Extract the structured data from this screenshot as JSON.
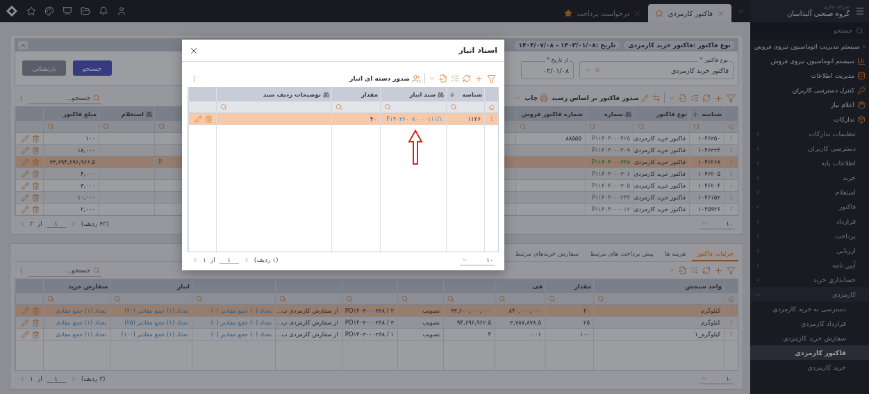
{
  "top_bar": {
    "company_caption": "شرکت جاری",
    "company": "گروه صنعتی آلیداسان",
    "tabs": [
      {
        "label": "فاکتور کارمزدی",
        "selected": true,
        "starred": false
      },
      {
        "label": "درخواست پرداخت",
        "selected": false,
        "starred": true
      }
    ]
  },
  "sidebar": {
    "search_placeholder": "جستجو",
    "items": [
      {
        "label": "سیستم مدیریت اتوماسیون نیروی فروش"
      },
      {
        "label": "سیستم اتوماسیون نیروی فروش"
      },
      {
        "label": "مدیریت اطلاعات"
      },
      {
        "label": "کنترل دسترسی کاربران"
      },
      {
        "label": "اعلام نیاز"
      },
      {
        "label": "تدارکات",
        "children": [
          {
            "label": "تنظیمات تدارکات",
            "expanded": false
          },
          {
            "label": "دسترسی کاربران",
            "expanded": false
          },
          {
            "label": "اطلاعات پایه",
            "expanded": false
          },
          {
            "label": "خرید",
            "expanded": false
          },
          {
            "label": "استعلام",
            "expanded": false
          },
          {
            "label": "فاکتور",
            "expanded": false
          },
          {
            "label": "قرارداد",
            "expanded": false
          },
          {
            "label": "پرداخت",
            "expanded": false
          },
          {
            "label": "ارزیابی",
            "expanded": false
          },
          {
            "label": "آیین نامه",
            "expanded": false
          },
          {
            "label": "حسابداری خرید",
            "expanded": false
          },
          {
            "label": "کارمزدی",
            "expanded": true,
            "children": [
              {
                "label": "دسترسی به خرید کارمزدی",
                "selected": false
              },
              {
                "label": "قرارداد کارمزدی",
                "selected": false
              },
              {
                "label": "سفارش خرید کارمزدی",
                "selected": false
              },
              {
                "label": "فاکتور کارمزدی",
                "selected": true
              },
              {
                "label": "خرید کارمزدی",
                "selected": false
              }
            ]
          }
        ]
      }
    ]
  },
  "filter": {
    "summary": [
      "نوع فاکتور :فاکتور خرید کارمزدی",
      "تاریخ :۱۴۰۳/۰۱/۰۸ - ۱۴۰۴/۰۷/۰۸"
    ],
    "fields": [
      {
        "kind": "select",
        "label": "نوع فاکتور *",
        "value": "فاکتور خرید کارمزدی"
      },
      {
        "kind": "date",
        "label": "از تاریخ *",
        "value": "۰۳/۰۱/۰۸"
      }
    ],
    "buttons": [
      {
        "kind": "primary",
        "label": "جستجو"
      },
      {
        "kind": "secondary",
        "label": "بازنشانی"
      }
    ]
  },
  "invoices": {
    "actions": [
      "صدور فاکتور بر اساس رسید",
      "چاپ"
    ],
    "search_placeholder": "جستجو...",
    "columns": [
      {
        "label": "شناسه",
        "sorted": true,
        "lookup": false,
        "kind": "text"
      },
      {
        "label": "نوع فاکتور",
        "sorted": false,
        "lookup": false,
        "kind": "text"
      },
      {
        "label": "شماره",
        "sorted": false,
        "lookup": true,
        "kind": "code"
      },
      {
        "label": "شماره فاکتور فروش",
        "sorted": false,
        "lookup": false,
        "kind": "text"
      },
      {
        "sorted": false,
        "lookup": false,
        "kind": "clipped"
      },
      {
        "label": "استعلام",
        "sorted": false,
        "lookup": true,
        "kind": "text"
      },
      {
        "label": "مبلغ فاکتور",
        "sorted": false,
        "lookup": false,
        "kind": "text"
      }
    ],
    "rows": [
      {
        "selected": false,
        "cells": [
          "۱۰۴۶۳۵۰",
          "فاکتور خرید کارمزدی",
          "P۱۱۴۰۴۰۰۰۴۲۵",
          "۸۸۵۵۵",
          null,
          null,
          "۱۰۰"
        ]
      },
      {
        "selected": false,
        "cells": [
          "۱۰۴۶۳۳۴",
          "فاکتور خرید کارمزدی",
          "P۱۱۴۰۴۰۰۰۴۰۹",
          null,
          null,
          null,
          "۱۸,۰۰۰"
        ]
      },
      {
        "selected": true,
        "cells": [
          "۱۰۴۶۲۶۸",
          "فاکتور خرید کارمزدی",
          "P۱۱۴۰۴۰۰۰۳۳۸",
          null,
          "P",
          null,
          "۳۳,۶۹۴,۶۹۶,۹۶۶.۵"
        ]
      },
      {
        "selected": false,
        "cells": [
          "۱۰۴۶۲۰۵",
          "فاکتور خرید کارمزدی",
          "P۱۱۴۰۴۰۰۰۳۰۶",
          null,
          null,
          null,
          "۴,۰۰۰"
        ]
      },
      {
        "selected": false,
        "cells": [
          "۱۰۴۶۲۰۴",
          "فاکتور خرید کارمزدی",
          "P۱۱۴۰۴۰۰۰۳۰۵",
          null,
          null,
          null,
          "۳,۰۰۰"
        ]
      },
      {
        "selected": false,
        "cells": [
          "۱۰۴۶۱۵۳",
          "فاکتور خرید کارمزدی",
          "P۱۱۴۰۴۰۰۰۲۴۴",
          null,
          null,
          null,
          "۱۰,۰۰۰"
        ]
      },
      {
        "selected": false,
        "cells": [
          "۱۰۴۵۹۲۶",
          "فاکتور خرید کارمزدی",
          "P۱۱۴۰۴۰۰۰۰۱۲",
          null,
          null,
          null,
          "۲,۰۰۰"
        ]
      }
    ],
    "pagination": {
      "page": "۱",
      "of": "از",
      "pages": "۳",
      "rows_label": "(۲۳ ردیف)",
      "page_size": "۱۰"
    }
  },
  "details": {
    "tabs": [
      {
        "label": "جزئیات فاکتور",
        "selected": true
      },
      {
        "label": "هزینه ها",
        "selected": false
      },
      {
        "label": "پیش پرداخت های مرتبط",
        "selected": false
      },
      {
        "label": "سفارش خریدهای مرتبط",
        "selected": false
      }
    ],
    "search_placeholder": "جستجو...",
    "columns": [
      {
        "label": "واحد سنجش",
        "kind": "text"
      },
      {
        "label": "مقدار",
        "kind": "text"
      },
      {
        "label": "فی",
        "kind": "text"
      },
      {
        "kind": "text"
      },
      {
        "kind": "text"
      },
      {
        "kind": "text"
      },
      {
        "kind": "text"
      },
      {
        "kind": "link"
      },
      {
        "label": "انبار",
        "kind": "link"
      },
      {
        "label": "سفارش خرید",
        "kind": "link"
      }
    ],
    "rows": [
      {
        "selected": true,
        "cells": [
          "کیلوگرم",
          "۴۰",
          "۸۴۰,۰۰۰,۰۰۰",
          "۳۳,۶۰۰,۰۰۰,۰۰۰",
          "تصویب",
          "PO۱۴۰۳۰۰۰۳۶۸ / ۲",
          "از سفارش کارمزدی ب...",
          "تعداد (۰) جمع مقادیر (۰)",
          "تعداد (۱) جمع مقادیر (۴۰)",
          "تعداد (۱) جمع مقادی"
        ]
      },
      {
        "selected": false,
        "cells": [
          "کیلوگرم",
          "۲۵",
          "۳,۷۸۷,۸۷۸.۵",
          "۹۴,۶۹۶,۹۶۲.۵",
          "تصویب",
          "PO۱۴۰۳۰۰۰۳۶۸ / ۳",
          "از سفارش کارمزدی ب...",
          "تعداد (۰) جمع مقادیر (۰)",
          "تعداد (۱) جمع مقادیر (۲۵)",
          "تعداد (۱) جمع مقادی"
        ]
      },
      {
        "selected": false,
        "cells": [
          "کیلوگرم_۱",
          "۱۰۰",
          "۰.۰۱",
          "۴",
          "تصویب",
          "PO۱۴۰۳۰۰۰۳۶۸ / ۱",
          "از سفارش کارمزدی ب...",
          "تعداد (۰) جمع مقادیر (۰)",
          "تعداد (۱) جمع مقادیر (۱۰۰)",
          "تعداد (۱) جمع مقادی"
        ]
      }
    ],
    "pagination": {
      "page": "۱",
      "of": "از",
      "pages": "۱",
      "rows_label": "(۳ ردیف)",
      "page_size": "۱۰"
    }
  },
  "modal": {
    "title": "اسناد انبار",
    "action": "صدور دسته ای انبار",
    "columns": [
      {
        "label": "شناسه",
        "sorted": true,
        "lookup": false,
        "kind": "text"
      },
      {
        "label": "سند انبار",
        "sorted": false,
        "lookup": true,
        "kind": "link"
      },
      {
        "label": "مقدار",
        "sorted": false,
        "lookup": false,
        "kind": "text"
      },
      {
        "label": "توضیحات ردیف سند",
        "sorted": false,
        "lookup": true,
        "kind": "text"
      }
    ],
    "rows": [
      {
        "selected": true,
        "cells": [
          "۱۱۲۶",
          "F۱۴۰۳۶۰۰۸۰۰۰۰۱۱۱/۱",
          "۴۰",
          null
        ]
      }
    ],
    "pagination": {
      "page": "۱",
      "of": "از",
      "pages": "۱",
      "rows_label": "(۱ ردیف)",
      "page_size": "۱۰"
    }
  }
}
